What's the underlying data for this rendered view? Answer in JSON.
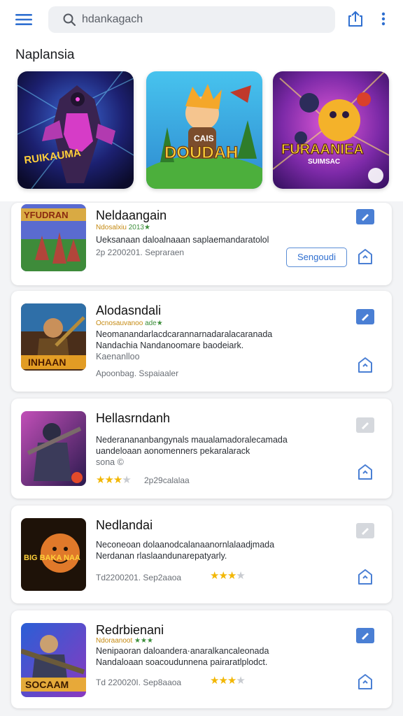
{
  "topbar": {
    "menu_icon": "hamburger-menu-icon",
    "search_value": "hdankagach",
    "search_icon": "search-icon",
    "share_icon": "share-icon",
    "more_icon": "more-vertical-icon"
  },
  "featured": {
    "title": "Naplansia",
    "cards": [
      {
        "art_text": "RUIKAUMA"
      },
      {
        "art_text": "DOUDAH",
        "art_small": "CAIS"
      },
      {
        "art_text": "FURAANIEA",
        "art_small": "SUIMSAC"
      }
    ]
  },
  "apps": [
    {
      "title": "Neldaangain",
      "rating_tag": "Ndosalxiu",
      "rating_text": "2013★",
      "desc": [
        "Ueksanaan daloalnaaan saplaemandaratolol"
      ],
      "meta": "2p 2200201.  Sepraraen",
      "button": "Sengoudi",
      "bookmark_active": true,
      "thumb_text": "YFUDRAN"
    },
    {
      "title": "Alodasndali",
      "rating_tag": "Ocnosauvanoo",
      "rating_text": "ade★",
      "desc": [
        "Neomanandarlacdcarannarnadaralacaranada",
        "Nandachia Nandanoomare baodeiark.",
        "Kaenanlloo"
      ],
      "meta": "Apoonbag.  Sspaiaaler",
      "bookmark_active": true,
      "thumb_text": "INHAAN"
    },
    {
      "title": "Hellasrndanh",
      "desc": [
        "Nederanananbangynals maualamadoralecamada",
        "uandeloaan aonomenners pekaralarack",
        "sona ©"
      ],
      "stars": 3,
      "stars_meta": "2p29calalaa",
      "bookmark_active": false,
      "thumb_text": ""
    },
    {
      "title": "Nedlandai",
      "desc": [
        "Neconeoan dolaanodcalanaanornlalaadjmada",
        "Nerdanan rlaslaandunarepatyarly."
      ],
      "meta": "Td2200201.  Sep2aaoa",
      "stars": 3,
      "bookmark_active": false,
      "thumb_text": "BIG BAKA NAA"
    },
    {
      "title": "Redrbienani",
      "rating_tag": "Ndoraanoot",
      "rating_text": "★★★",
      "desc": [
        "Nenipaoran daloandera·anaralkancaleonada",
        "Nandaloaan soacoudunnena pairaratlplodct."
      ],
      "meta": "Td 220020I.  Sep8aaoa",
      "stars": 3,
      "bookmark_active": true,
      "thumb_text": "SOCAAM"
    }
  ],
  "colors": {
    "accent": "#4a7fd4",
    "star": "#f2b705",
    "bookmark_active": "#4a7fd4",
    "bookmark_inactive": "#d5d8dd"
  }
}
